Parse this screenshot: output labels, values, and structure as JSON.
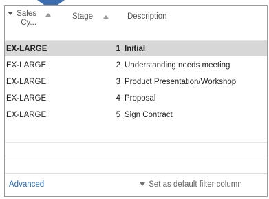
{
  "columns": [
    {
      "label_line1": "Sales",
      "label_line2": "Cy..."
    },
    {
      "label": "Stage"
    },
    {
      "label": "Description"
    }
  ],
  "rows": [
    {
      "sales_cycle": "EX-LARGE",
      "stage": "1",
      "description": "Initial",
      "selected": true
    },
    {
      "sales_cycle": "EX-LARGE",
      "stage": "2",
      "description": "Understanding needs meeting",
      "selected": false
    },
    {
      "sales_cycle": "EX-LARGE",
      "stage": "3",
      "description": "Product Presentation/Workshop",
      "selected": false
    },
    {
      "sales_cycle": "EX-LARGE",
      "stage": "4",
      "description": "Proposal",
      "selected": false
    },
    {
      "sales_cycle": "EX-LARGE",
      "stage": "5",
      "description": "Sign Contract",
      "selected": false
    }
  ],
  "footer": {
    "advanced_label": "Advanced",
    "set_default_label": "Set as default filter column"
  },
  "colors": {
    "selected_row": "#d7d7d7",
    "link": "#2a6ebb",
    "pointer": "#3d6fb0"
  }
}
